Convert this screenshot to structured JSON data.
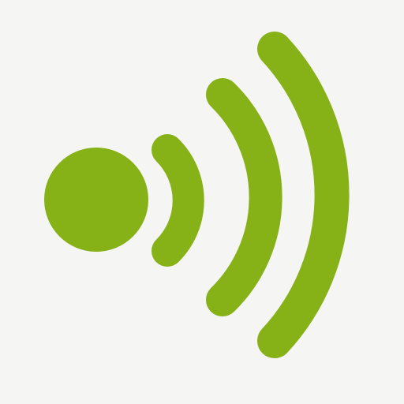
{
  "icon": {
    "name": "wireless-signal-icon",
    "wave_count": 3
  },
  "colors": {
    "background": "#f5f5f4",
    "accent": "#86b117"
  }
}
